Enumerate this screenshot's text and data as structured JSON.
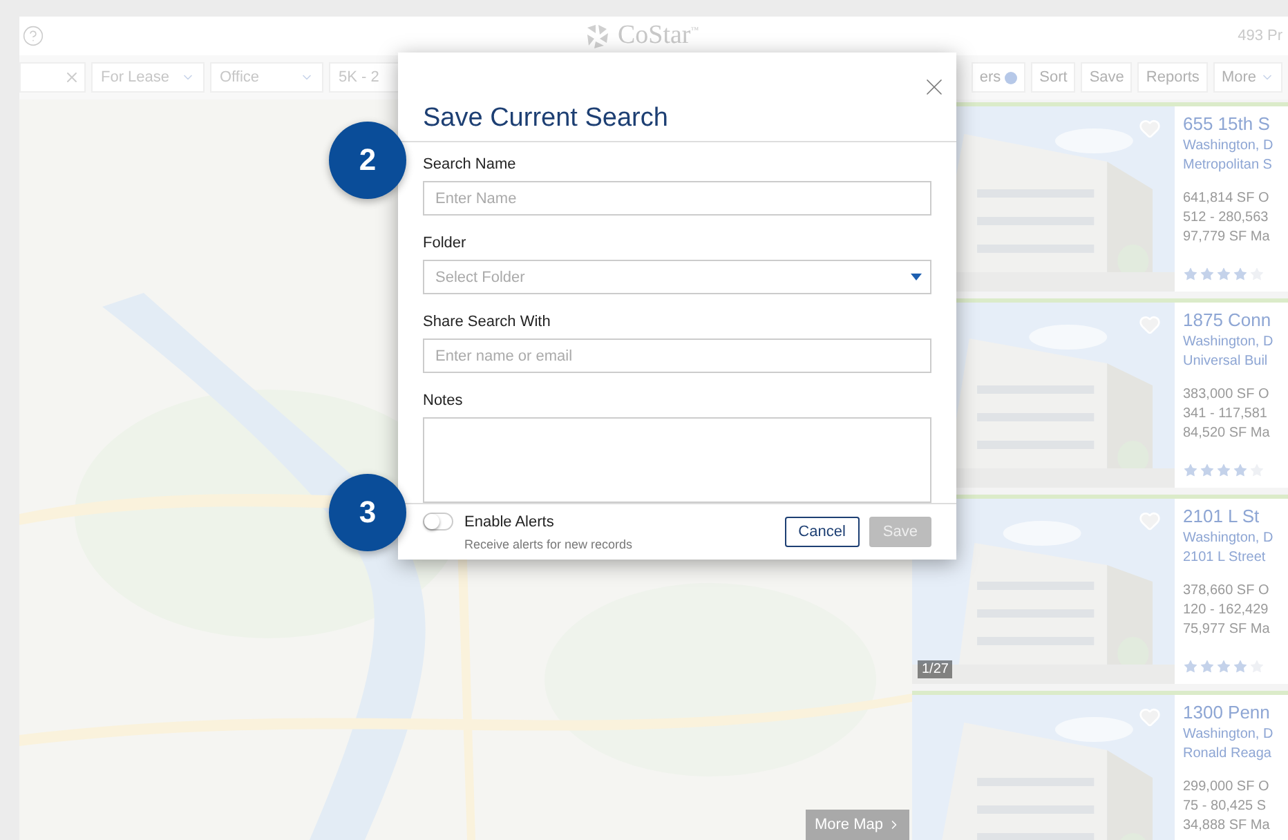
{
  "header": {
    "logo": "CoStar$^{™}$",
    "result_count": "493 Pr"
  },
  "toolbar": {
    "filters": [
      {
        "label": "For Lease",
        "kind": "dropdown"
      },
      {
        "label": "Office",
        "kind": "dropdown"
      },
      {
        "label": "5K - 2",
        "kind": "partial"
      }
    ],
    "actions": [
      {
        "label": "ers",
        "kind": "badge"
      },
      {
        "label": "Sort",
        "kind": "plain"
      },
      {
        "label": "Save",
        "kind": "plain"
      },
      {
        "label": "Reports",
        "kind": "plain"
      },
      {
        "label": "More",
        "kind": "menu"
      }
    ]
  },
  "map": {
    "more_button": "More Map"
  },
  "listings": [
    {
      "title": "655 15th S",
      "city": "Washington, D",
      "building": "Metropolitan S",
      "details": [
        "641,814 SF O",
        "512 - 280,563",
        "97,779 SF Ma"
      ],
      "stars": 4
    },
    {
      "title": "1875 Conn",
      "city": "Washington, D",
      "building": "Universal Buil",
      "details": [
        "383,000 SF O",
        "341 - 117,581",
        "84,520 SF Ma"
      ],
      "stars": 4
    },
    {
      "title": "2101 L St",
      "city": "Washington, D",
      "building": "2101 L Street",
      "details": [
        "378,660 SF O",
        "120 - 162,429",
        "75,977 SF Ma"
      ],
      "stars": 4,
      "photo_counter": "1/27"
    },
    {
      "title": "1300 Penn",
      "city": "Washington, D",
      "building": "Ronald Reaga",
      "details": [
        "299,000 SF O",
        "75 - 80,425 S",
        "34,888 SF Ma"
      ]
    }
  ],
  "dialog": {
    "title": "Save Current Search",
    "fields": [
      {
        "label": "Search Name",
        "placeholder": "Enter Name",
        "kind": "text"
      },
      {
        "label": "Folder",
        "placeholder": "Select Folder",
        "kind": "select"
      },
      {
        "label": "Share Search With",
        "placeholder": "Enter name or email",
        "kind": "text"
      },
      {
        "label": "Notes",
        "kind": "textarea"
      }
    ],
    "alerts": {
      "label": "Enable Alerts",
      "hint": "Receive alerts for new records",
      "on": false
    },
    "buttons": [
      {
        "label": "Cancel",
        "disabled": false
      },
      {
        "label": "Save",
        "disabled": true
      }
    ]
  },
  "callouts": [
    "2",
    "3"
  ]
}
